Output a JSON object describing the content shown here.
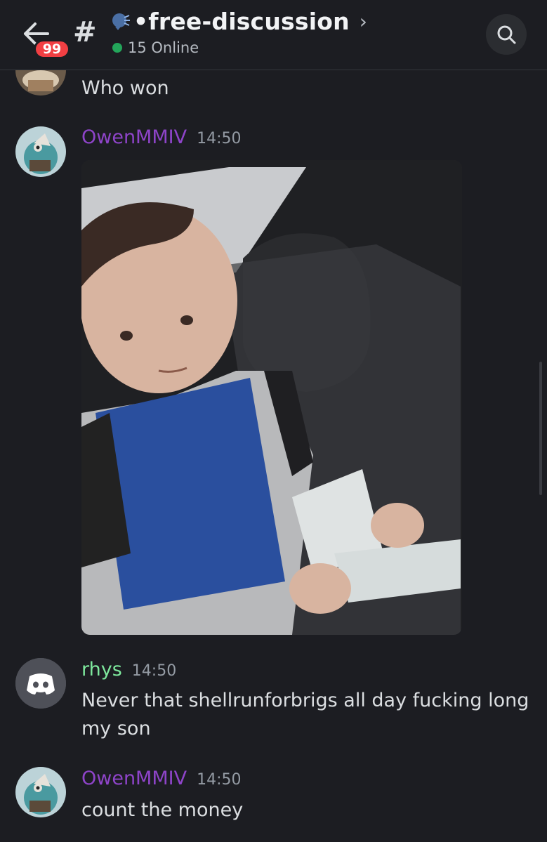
{
  "header": {
    "unread_count": "99",
    "hash_symbol": "#",
    "channel_name": "•free-discussion",
    "chevron": "›",
    "online_text": "15 Online"
  },
  "messages": [
    {
      "author": "",
      "time": "",
      "text": "Who won"
    },
    {
      "author": "OwenMMIV",
      "time": "14:50",
      "text": "",
      "attachment": "gif-image"
    },
    {
      "author": "rhys",
      "time": "14:50",
      "text_line1": "Never that shellrunforbrigs all day fucking long",
      "text_line2": "my son"
    },
    {
      "author": "OwenMMIV",
      "time": "14:50",
      "text": "count the money"
    }
  ],
  "colors": {
    "background": "#1c1d22",
    "owen_name": "#8e44c9",
    "rhys_name": "#7ee89d",
    "badge_red": "#f23f43",
    "online_green": "#23a55a"
  },
  "icons": [
    "back-arrow-icon",
    "speaker-emoji-icon",
    "search-icon",
    "discord-logo-icon"
  ]
}
